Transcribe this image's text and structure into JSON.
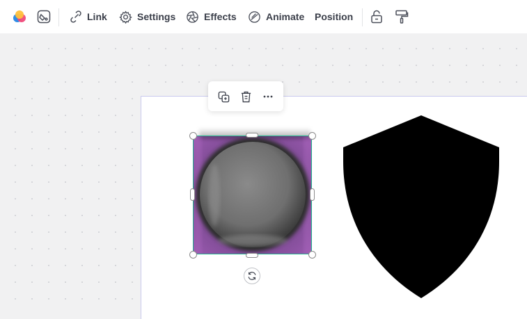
{
  "toolbar": {
    "link_label": "Link",
    "settings_label": "Settings",
    "effects_label": "Effects",
    "animate_label": "Animate",
    "position_label": "Position"
  },
  "icons": {
    "color": "color-palette-icon",
    "fill": "paint-bucket-icon",
    "link": "link-icon",
    "settings": "gear-icon",
    "effects": "effects-aperture-icon",
    "animate": "animate-icon",
    "lock": "unlock-icon",
    "style": "paint-roller-icon",
    "duplicate": "duplicate-icon",
    "delete": "trash-icon",
    "more": "more-icon",
    "rotate": "rotate-icon"
  },
  "colors": {
    "selection": "#20b38f",
    "image_background": "#8b4f9a",
    "shield": "#000000"
  }
}
